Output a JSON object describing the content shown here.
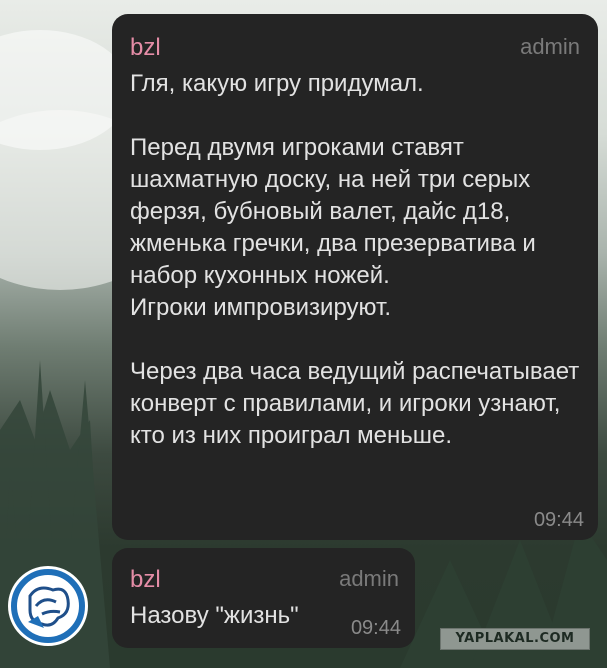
{
  "messages": [
    {
      "sender": "bzl",
      "role": "admin",
      "text": "Гля, какую игру придумал.\n\nПеред двумя игроками ставят шахматную доску, на ней три серых ферзя, бубновый валет, дайс д18, жменька гречки, два презерватива и набор кухонных ножей.\nИгроки импровизируют.\n\nЧерез два часа ведущий распечатывает конверт с правилами, и игроки узнают, кто из них проиграл меньше.",
      "time": "09:44"
    },
    {
      "sender": "bzl",
      "role": "admin",
      "text": "Назову \"жизнь\"",
      "time": "09:44"
    }
  ],
  "watermark": "YAPLAKAL.COM",
  "colors": {
    "bubble": "#242424",
    "sender": "#e58da7",
    "meta": "#7a7a7a",
    "avatar_ring": "#1f6fb8"
  }
}
